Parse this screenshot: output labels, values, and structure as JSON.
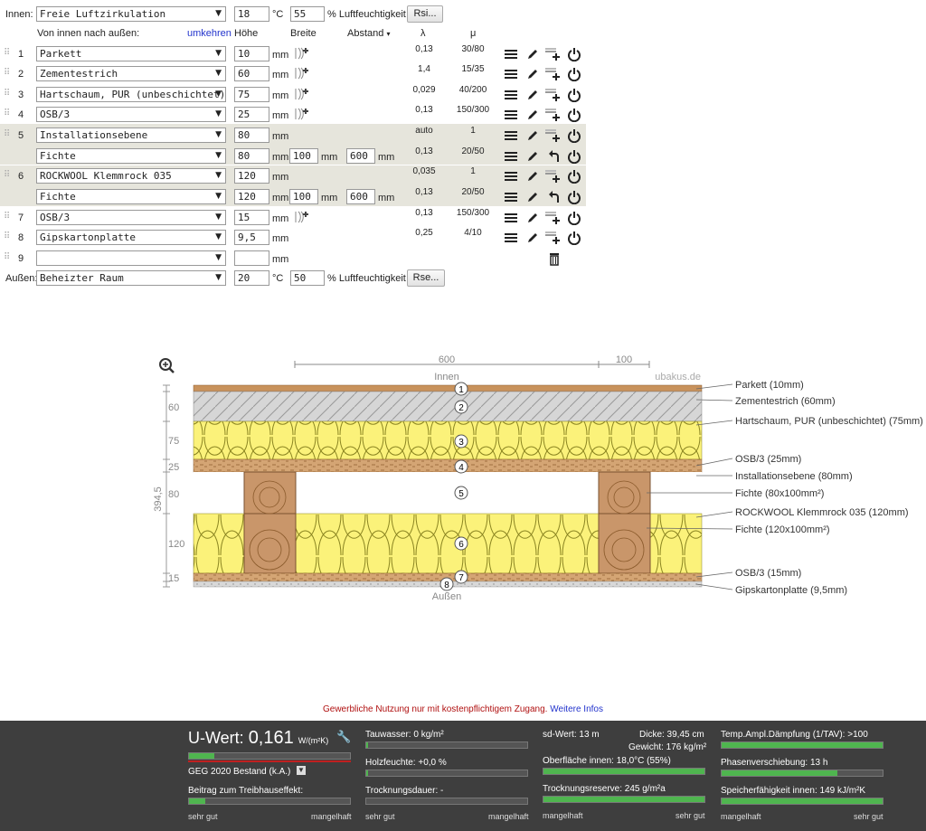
{
  "inner": {
    "label": "Innen:",
    "preset": "Freie Luftzirkulation",
    "temp": "18",
    "temp_unit": "°C",
    "humidity": "55",
    "humidity_label": "% Luftfeuchtigkeit",
    "btn": "Rsi..."
  },
  "outer": {
    "label": "Außen:",
    "preset": "Beheizter Raum",
    "temp": "20",
    "temp_unit": "°C",
    "humidity": "50",
    "humidity_label": "% Luftfeuchtigkeit",
    "btn": "Rse..."
  },
  "header": {
    "order": "Von innen nach außen:",
    "reverse": "umkehren",
    "height": "Höhe",
    "width": "Breite",
    "spacing": "Abstand",
    "spacing_sort": "▾",
    "lambda": "λ",
    "mu": "μ"
  },
  "unit_mm": "mm",
  "layers": [
    {
      "n": "1",
      "material": "Parkett",
      "h": "10",
      "lambda": "0,13",
      "mu": "30/80"
    },
    {
      "n": "2",
      "material": "Zementestrich",
      "h": "60",
      "lambda": "1,4",
      "mu": "15/35"
    },
    {
      "n": "3",
      "material": "Hartschaum, PUR (unbeschichtet)",
      "h": "75",
      "lambda": "0,029",
      "mu": "40/200"
    },
    {
      "n": "4",
      "material": "OSB/3",
      "h": "25",
      "lambda": "0,13",
      "mu": "150/300"
    },
    {
      "n": "5",
      "material": "Installationsebene",
      "h": "80",
      "lambda": "auto",
      "mu": "1"
    },
    {
      "n": "",
      "material": "Fichte",
      "h": "80",
      "w": "100",
      "spacing": "600",
      "lambda": "0,13",
      "mu": "20/50"
    },
    {
      "n": "6",
      "material": "ROCKWOOL Klemmrock 035",
      "h": "120",
      "lambda": "0,035",
      "mu": "1"
    },
    {
      "n": "",
      "material": "Fichte",
      "h": "120",
      "w": "100",
      "spacing": "600",
      "lambda": "0,13",
      "mu": "20/50"
    },
    {
      "n": "7",
      "material": "OSB/3",
      "h": "15",
      "lambda": "0,13",
      "mu": "150/300"
    },
    {
      "n": "8",
      "material": "Gipskartonplatte",
      "h": "9,5",
      "lambda": "0,25",
      "mu": "4/10"
    },
    {
      "n": "9",
      "material": "",
      "h": "",
      "lambda": "",
      "mu": ""
    }
  ],
  "diagram": {
    "dim_top_600": "600",
    "dim_top_100": "100",
    "inside": "Innen",
    "outside": "Außen",
    "watermark": "ubakus.de",
    "total": "394,5",
    "left_dims": [
      "60",
      "75",
      "25",
      "80",
      "120",
      "15"
    ],
    "circle_numbers": [
      "1",
      "2",
      "3",
      "4",
      "5",
      "6",
      "7",
      "8"
    ],
    "legend": [
      "Parkett (10mm)",
      "Zementestrich (60mm)",
      "Hartschaum, PUR (unbeschichtet) (75mm)",
      "OSB/3 (25mm)",
      "Installationsebene (80mm)",
      "Fichte (80x100mm²)",
      "ROCKWOOL Klemmrock 035 (120mm)",
      "Fichte (120x100mm²)",
      "OSB/3 (15mm)",
      "Gipskartonplatte (9,5mm)"
    ]
  },
  "notice": {
    "text": "Gewerbliche Nutzung nur mit kostenpflichtigem Zugang.",
    "link": "Weitere Infos"
  },
  "footer": {
    "uwert_label": "U-Wert:",
    "uwert_value": "0,161",
    "uwert_unit": "W/(m²K)",
    "standard": "GEG 2020 Bestand (k.A.)",
    "greenhouse": "Beitrag zum Treibhauseffekt:",
    "good": "sehr gut",
    "bad": "mangelhaft",
    "condensate": "Tauwasser: 0 kg/m²",
    "wood_moisture": "Holzfeuchte: +0,0 %",
    "drying": "Trocknungsdauer: -",
    "sd": "sd-Wert: 13 m",
    "thickness": "Dicke: 39,45 cm",
    "weight": "Gewicht: 176 kg/m²",
    "surface": "Oberfläche innen: 18,0°C (55%)",
    "reserve": "Trocknungsreserve: 245 g/m²a",
    "damping": "Temp.Ampl.Dämpfung (1/TAV): >100",
    "phase": "Phasenverschiebung: 13 h",
    "capacity": "Speicherfähigkeit innen: 149 kJ/m²K"
  }
}
